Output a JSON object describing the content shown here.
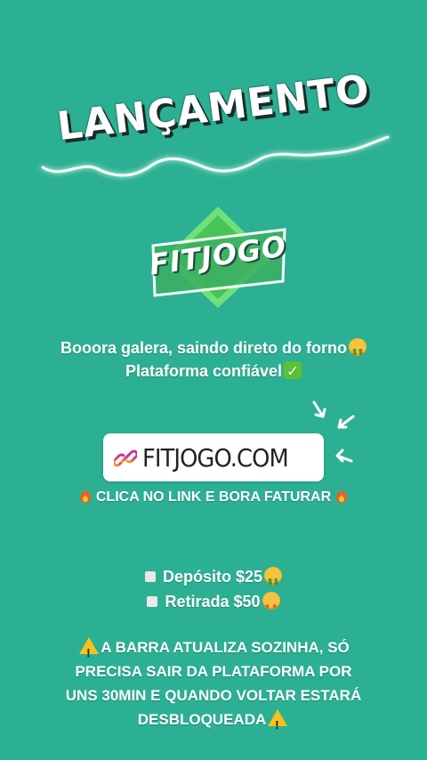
{
  "banner": {
    "title": "LANÇAMENTO"
  },
  "logo": {
    "text": "FITJOGO"
  },
  "intro": {
    "line1": "Booora galera, saindo direto do forno",
    "line2": "Plataforma confiável"
  },
  "link": {
    "label": "FITJOGO.COM"
  },
  "cta": {
    "label": "CLICA NO LINK E BORA FATURAR"
  },
  "info": {
    "deposit": "Depósito $25",
    "withdrawal": "Retirada $50"
  },
  "warning": {
    "line1": "A BARRA ATUALIZA SOZINHA, SÓ",
    "line2": "PRECISA SAIR DA PLATAFORMA POR",
    "line3": "UNS 30MIN E QUANDO VOLTAR ESTARÁ",
    "line4": "DESBLOQUEADA"
  },
  "icons": {
    "money": "money-mouth-face-icon",
    "check": "check-mark-icon",
    "fire": "fire-icon",
    "star": "star-struck-face-icon",
    "warning": "warning-icon",
    "link": "link-icon",
    "arrows": "pointing-arrows-icon"
  },
  "colors": {
    "background": "#2cb093",
    "logo_green": "#5fd06a",
    "link_gradient_start": "#f2b022",
    "link_gradient_end": "#b02fc0",
    "warning_yellow": "#f6c21a"
  }
}
